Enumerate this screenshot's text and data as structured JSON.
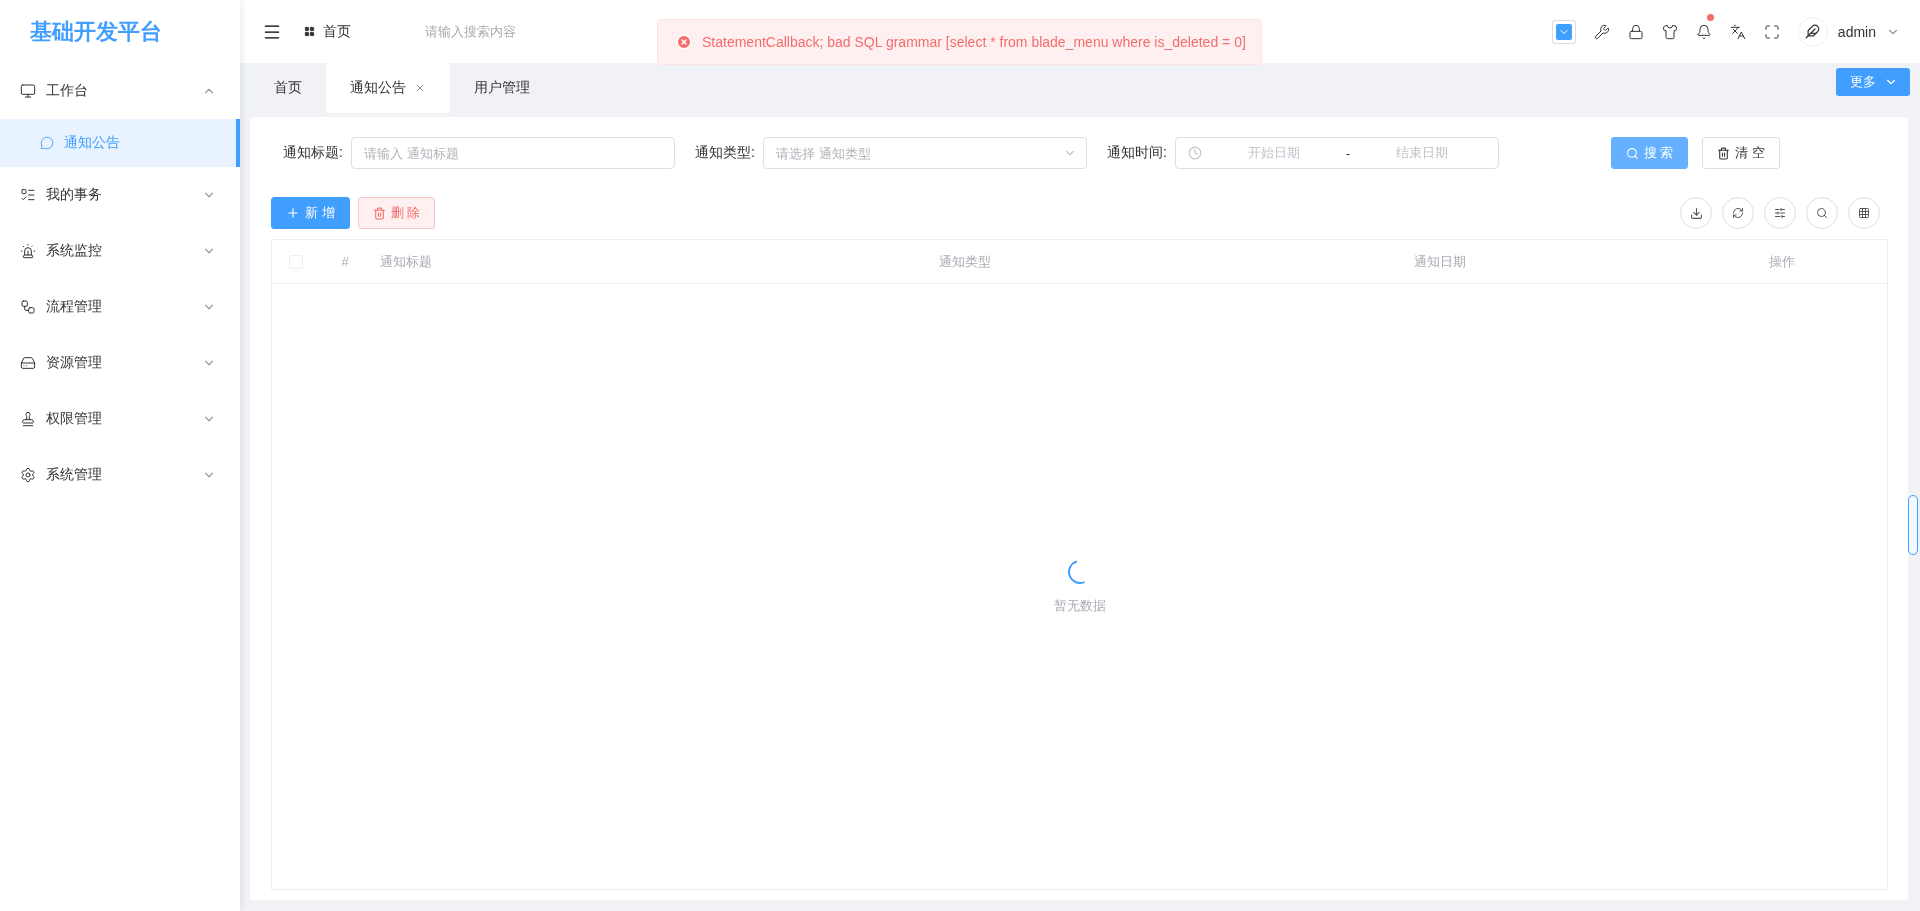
{
  "logo": "基础开发平台",
  "sidebar": {
    "items": [
      {
        "label": "工作台",
        "expanded": true,
        "children": [
          {
            "label": "通知公告",
            "selected": true
          }
        ]
      },
      {
        "label": "我的事务",
        "expanded": false
      },
      {
        "label": "系统监控",
        "expanded": false
      },
      {
        "label": "流程管理",
        "expanded": false
      },
      {
        "label": "资源管理",
        "expanded": false
      },
      {
        "label": "权限管理",
        "expanded": false
      },
      {
        "label": "系统管理",
        "expanded": false
      }
    ]
  },
  "header": {
    "breadcrumb": "首页",
    "search": {
      "placeholder": "请输入搜索内容"
    },
    "notification_dot": true,
    "user": "admin"
  },
  "toast": {
    "message": "StatementCallback; bad SQL grammar [select * from blade_menu where is_deleted = 0]"
  },
  "tabs": [
    {
      "label": "首页",
      "selected": false
    },
    {
      "label": "通知公告",
      "selected": true
    },
    {
      "label": "用户管理",
      "selected": false
    }
  ],
  "more_button": "更多",
  "filters": [
    {
      "kind": "input",
      "label": "通知标题:",
      "placeholder": "请输入 通知标题"
    },
    {
      "kind": "select",
      "label": "通知类型:",
      "placeholder": "请选择 通知类型"
    },
    {
      "kind": "daterange",
      "label": "通知时间:",
      "start_placeholder": "开始日期",
      "separator": "-",
      "end_placeholder": "结束日期"
    }
  ],
  "search_button": "搜 索",
  "clear_button": "清 空",
  "add_button": "新 增",
  "delete_button": "删 除",
  "table": {
    "columns": [
      {
        "kind": "checkbox"
      },
      {
        "kind": "index",
        "label": "#"
      },
      {
        "kind": "text",
        "label": "通知标题"
      },
      {
        "kind": "text",
        "label": "通知类型"
      },
      {
        "kind": "text",
        "label": "通知日期"
      },
      {
        "kind": "action",
        "label": "操作"
      }
    ],
    "loading": true,
    "empty_text": "暂无数据"
  }
}
